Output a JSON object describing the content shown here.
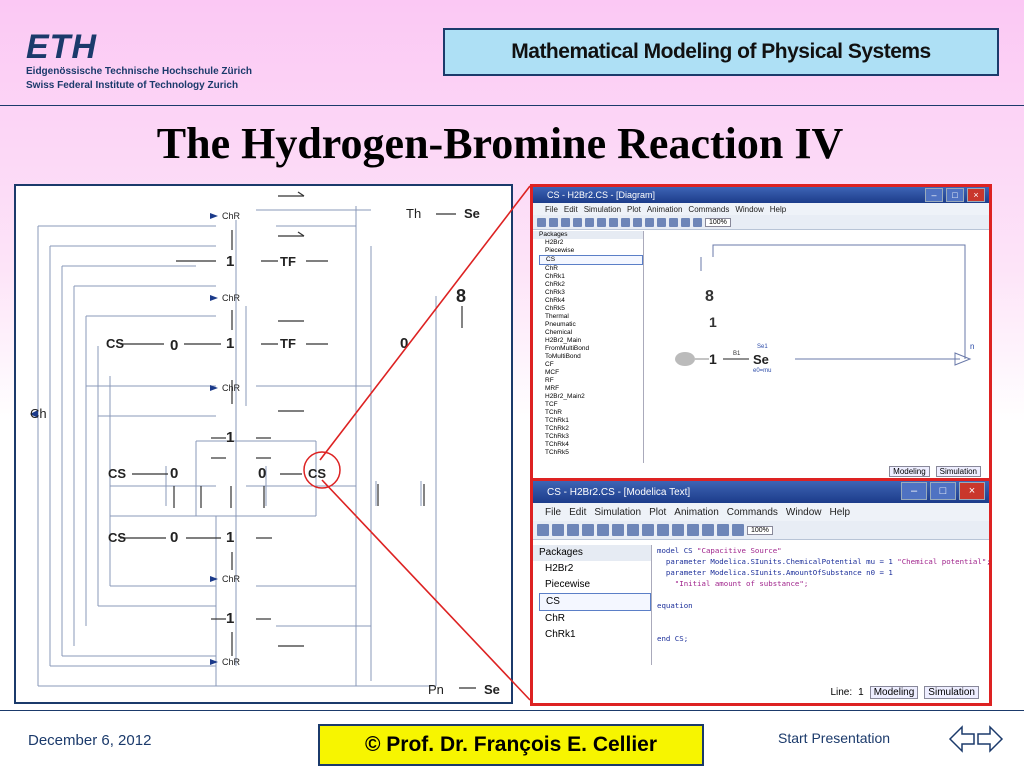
{
  "header": {
    "logo": "ETH",
    "logo_line1": "Eidgenössische Technische Hochschule Zürich",
    "logo_line2": "Swiss Federal Institute of Technology Zurich",
    "course_title": "Mathematical Modeling of Physical Systems"
  },
  "slide": {
    "title": "The Hydrogen-Bromine Reaction IV"
  },
  "diagram": {
    "nodes": {
      "ch": "Ch",
      "th": "Th",
      "se_top": "Se",
      "pn": "Pn",
      "se_bottom": "Se",
      "chr1": "ChR",
      "chr2": "ChR",
      "chr3": "ChR",
      "chr4": "ChR",
      "chr5": "ChR",
      "cs1": "CS",
      "cs2": "CS",
      "cs3": "CS",
      "cs4": "CS",
      "tf1": "TF",
      "tf2": "TF",
      "one": "1",
      "zero": "0",
      "eight": "8"
    }
  },
  "window_top": {
    "title": "CS - H2Br2.CS - [Diagram]",
    "menu": [
      "File",
      "Edit",
      "Simulation",
      "Plot",
      "Animation",
      "Commands",
      "Window",
      "Help"
    ],
    "zoom": "100%",
    "packages_header": "Packages",
    "tree": [
      "H2Br2",
      "Piecewise",
      "CS",
      "ChR",
      "ChRk1",
      "ChRk2",
      "ChRk3",
      "ChRk4",
      "ChRk5",
      "Thermal",
      "Pneumatic",
      "Chemical",
      "H2Br2_Main",
      "FromMultiBond",
      "ToMultiBond",
      "CF",
      "MCF",
      "RF",
      "MRF",
      "H2Br2_Main2",
      "TCF",
      "TChR",
      "TChRk1",
      "TChRk2",
      "TChRk3",
      "TChRk4",
      "TChRk5"
    ],
    "canvas": {
      "one": "1",
      "se": "Se",
      "se_index": "Se1",
      "se_sub": "e0=mu",
      "bond_label": "B1",
      "n": "n"
    },
    "tabs": [
      "Modeling",
      "Simulation"
    ]
  },
  "window_bottom": {
    "title": "CS - H2Br2.CS - [Modelica Text]",
    "menu": [
      "File",
      "Edit",
      "Simulation",
      "Plot",
      "Animation",
      "Commands",
      "Window",
      "Help"
    ],
    "zoom": "100%",
    "packages_header": "Packages",
    "tree": [
      "H2Br2",
      "Piecewise",
      "CS",
      "ChR",
      "ChRk1"
    ],
    "code": {
      "l1a": "model CS ",
      "l1b": "\"Capacitive Source\"",
      "l2a": "  parameter Modelica.SIunits.ChemicalPotential mu = 1 ",
      "l2b": "\"Chemical potential\";",
      "l3": "  parameter Modelica.SIunits.AmountOfSubstance n0 = 1",
      "l4": "    \"Initial amount of substance\";",
      "l5": "equation",
      "l6": "end CS;"
    },
    "status_line_label": "Line:",
    "status_line_value": "1",
    "tabs": [
      "Modeling",
      "Simulation"
    ]
  },
  "footer": {
    "date": "December 6, 2012",
    "author": "©  Prof. Dr. François E. Cellier",
    "start": "Start Presentation"
  },
  "colors": {
    "accent": "#1b3a6b",
    "highlight": "#dd2222",
    "author_box": "#f7f500",
    "course_box": "#aee0f5"
  }
}
